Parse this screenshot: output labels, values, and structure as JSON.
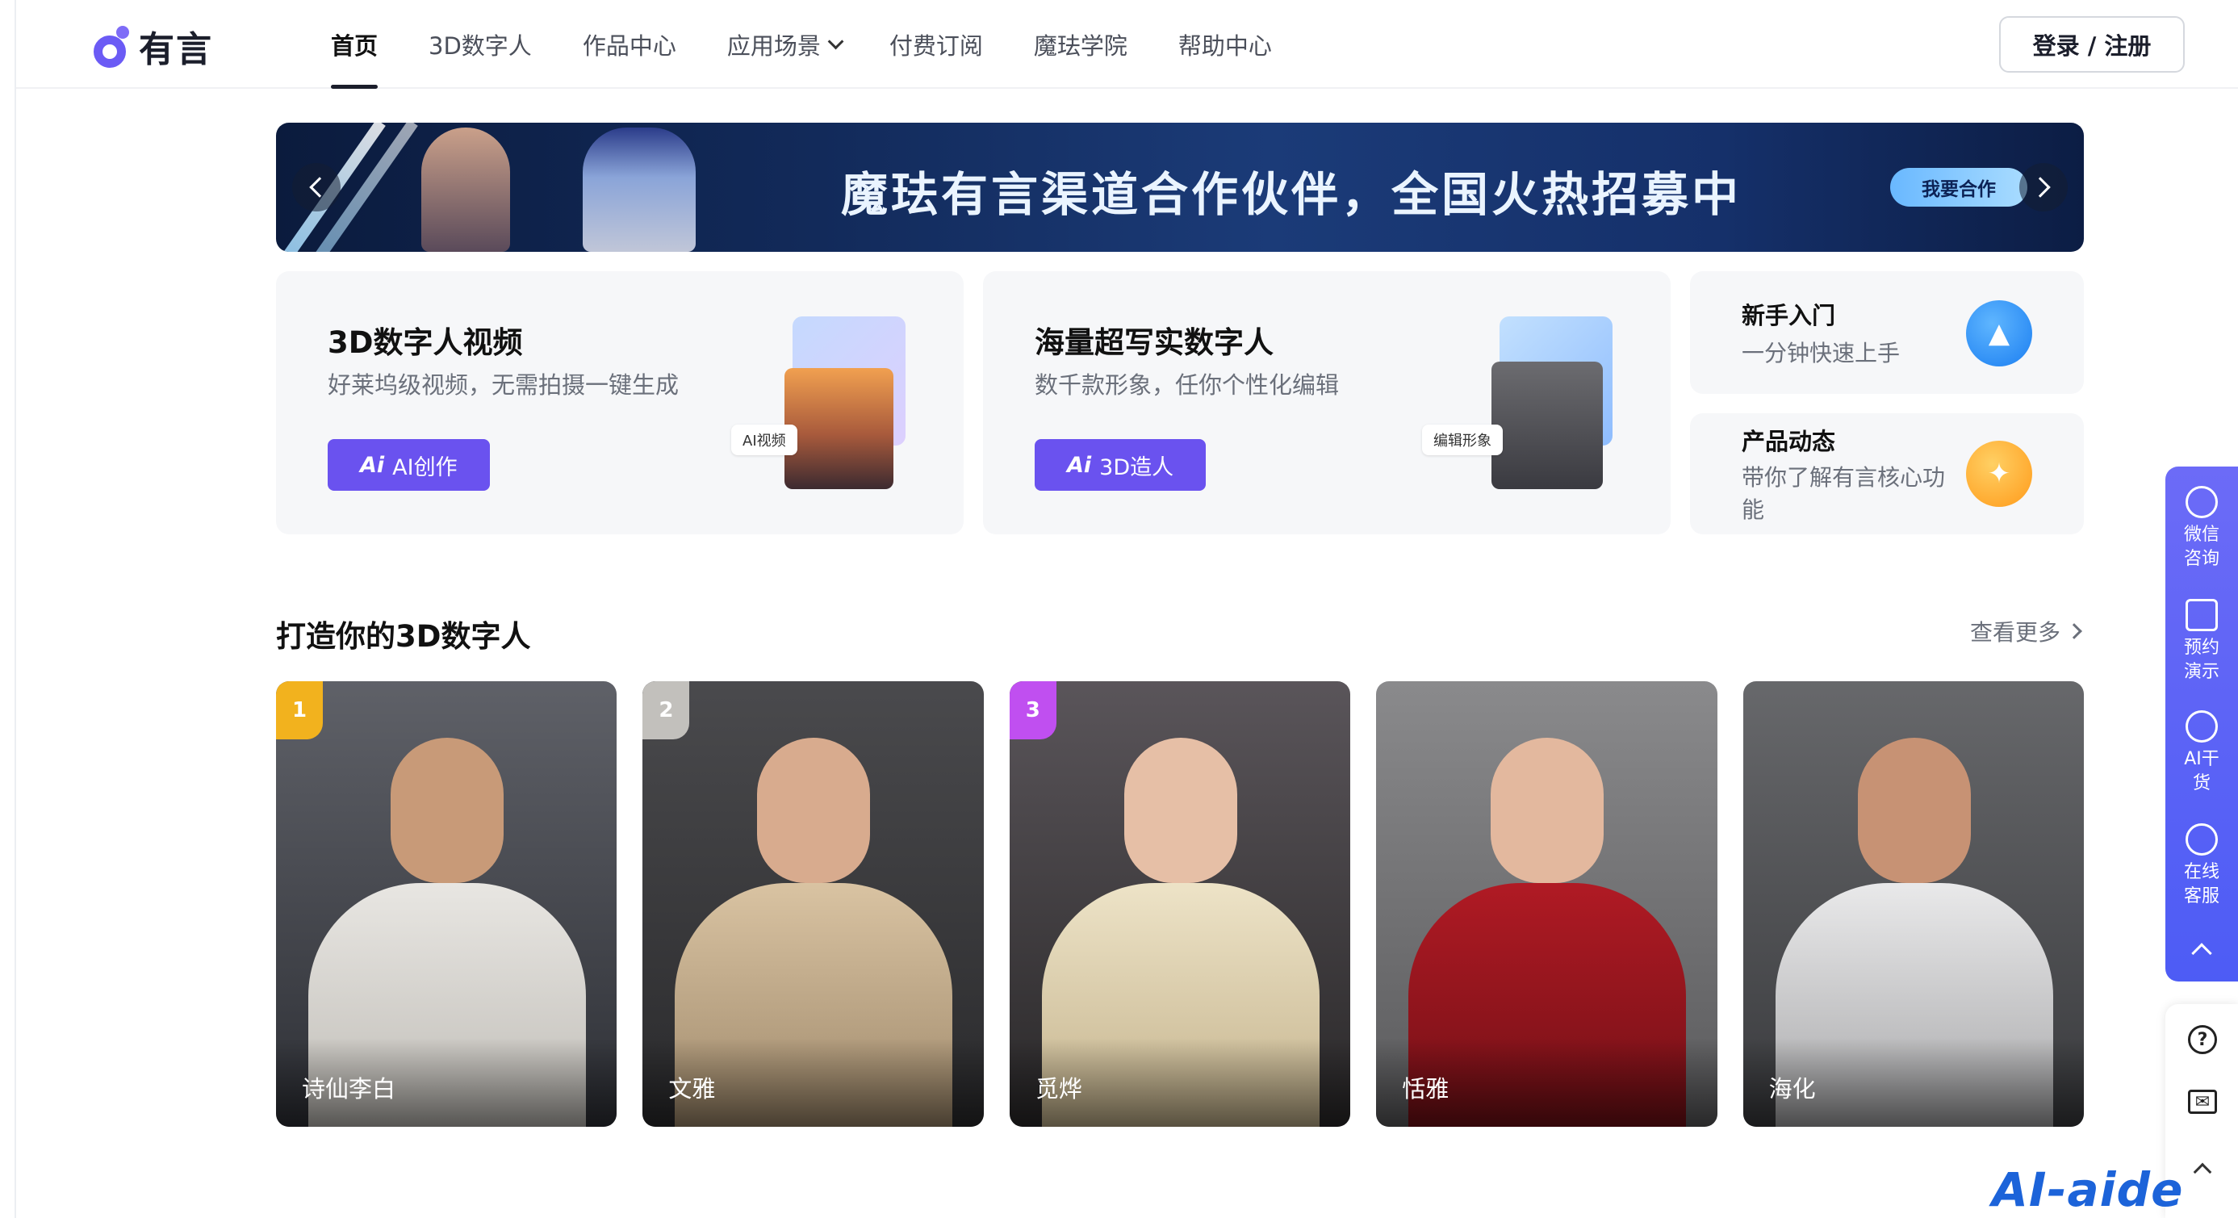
{
  "header": {
    "logo_text": "有言",
    "nav": [
      {
        "label": "首页",
        "active": true
      },
      {
        "label": "3D数字人"
      },
      {
        "label": "作品中心"
      },
      {
        "label": "应用场景",
        "dropdown": true
      },
      {
        "label": "付费订阅"
      },
      {
        "label": "魔珐学院"
      },
      {
        "label": "帮助中心"
      }
    ],
    "login_label": "登录 / 注册"
  },
  "banner": {
    "title": "魔珐有言渠道合作伙伴，全国火热招募中",
    "cta": "我要合作"
  },
  "features": [
    {
      "title": "3D数字人视频",
      "subtitle": "好莱坞级视频，无需拍摄一键生成",
      "button_icon": "Ai",
      "button": "AI创作",
      "tag": "AI视频"
    },
    {
      "title": "海量超写实数字人",
      "subtitle": "数千款形象，任你个性化编辑",
      "button_icon": "Ai",
      "button": "3D造人",
      "tag": "编辑形象"
    }
  ],
  "side_cards": [
    {
      "title": "新手入门",
      "subtitle": "一分钟快速上手",
      "icon": "graduation-cap-icon",
      "accent": "#1b7ef1"
    },
    {
      "title": "产品动态",
      "subtitle": "带你了解有言核心功能",
      "icon": "gift-box-icon",
      "accent": "#ff9a1a"
    }
  ],
  "section": {
    "title": "打造你的3D数字人",
    "more": "查看更多"
  },
  "avatars": [
    {
      "name": "诗仙李白",
      "rank": "1"
    },
    {
      "name": "文雅",
      "rank": "2"
    },
    {
      "name": "觅烨",
      "rank": "3"
    },
    {
      "name": "恬雅",
      "rank": ""
    },
    {
      "name": "海化",
      "rank": ""
    }
  ],
  "float_bar": [
    {
      "label": "微信咨询",
      "icon": "wechat-icon"
    },
    {
      "label": "预约演示",
      "icon": "presentation-icon"
    },
    {
      "label": "AI干货",
      "icon": "robot-icon"
    },
    {
      "label": "在线客服",
      "icon": "headset-icon"
    }
  ],
  "tools": {
    "help_glyph": "?",
    "mail_glyph": "✉"
  },
  "watermark": "AI-aide",
  "colors": {
    "brand": "#6a52ef",
    "float_bar": "#5b64f6"
  }
}
